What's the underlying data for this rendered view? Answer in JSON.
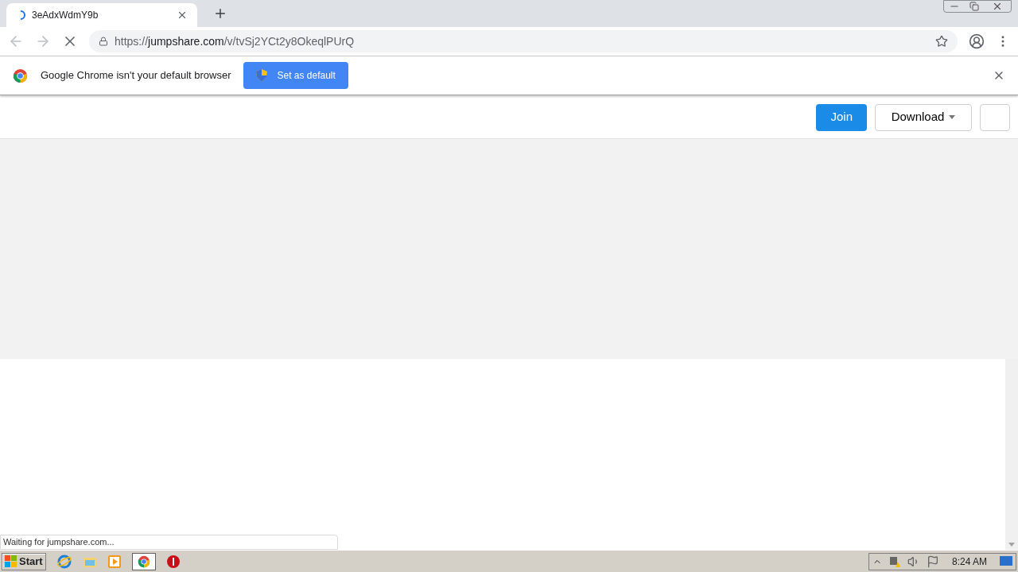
{
  "tab": {
    "title": "3eAdxWdmY9b",
    "loading": true
  },
  "address": {
    "scheme": "https://",
    "host": "jumpshare.com",
    "path": "/v/tvSj2YCt2y8OkeqlPUrQ"
  },
  "infobar": {
    "message": "Google Chrome isn't your default browser",
    "button": "Set as default"
  },
  "header": {
    "join": "Join",
    "download": "Download"
  },
  "status": "Waiting for jumpshare.com...",
  "taskbar": {
    "start": "Start",
    "clock": "8:24 AM"
  }
}
